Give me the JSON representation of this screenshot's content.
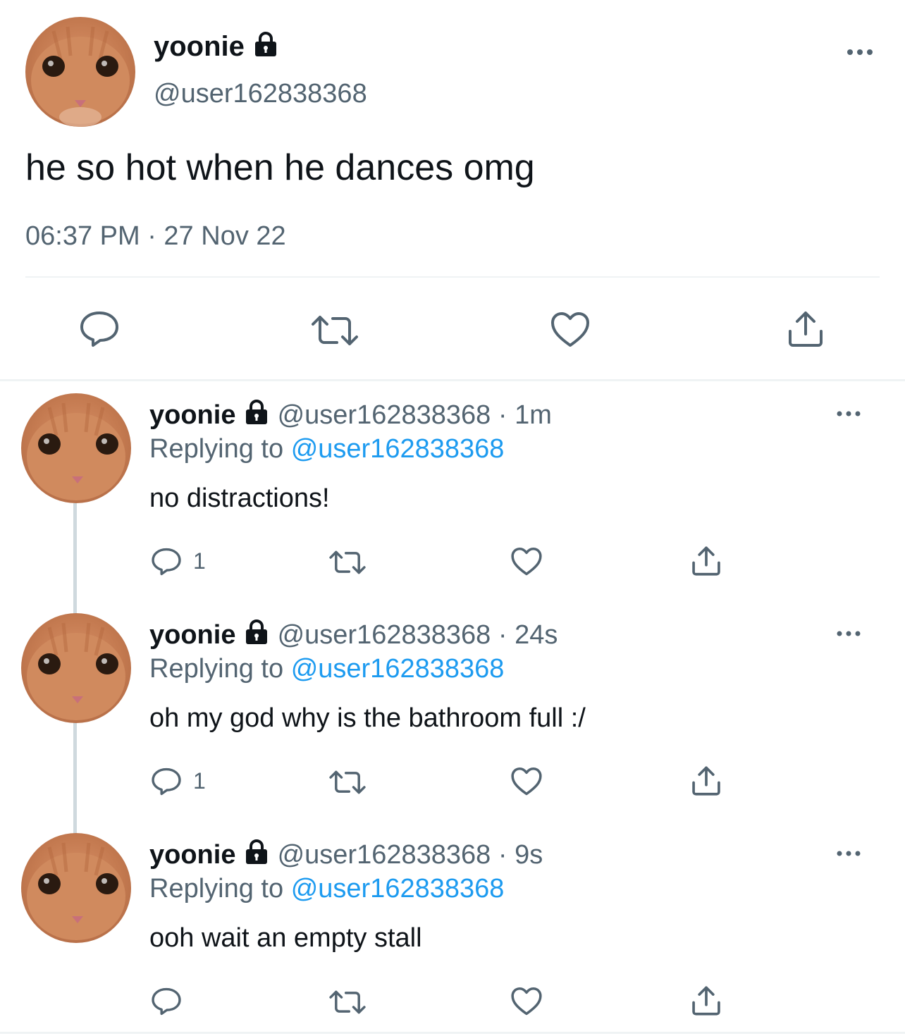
{
  "main_tweet": {
    "name": "yoonie",
    "handle": "@user162838368",
    "text": "he so hot when he dances omg",
    "timestamp": "06:37 PM · 27 Nov 22"
  },
  "replies": [
    {
      "name": "yoonie",
      "handle_time": "@user162838368 · 1m",
      "replying_prefix": "Replying to",
      "replying_to": "@user162838368",
      "text": "no distractions!",
      "reply_count": "1"
    },
    {
      "name": "yoonie",
      "handle_time": "@user162838368 · 24s",
      "replying_prefix": "Replying to",
      "replying_to": "@user162838368",
      "text": "oh my god why is the bathroom full :/",
      "reply_count": "1"
    },
    {
      "name": "yoonie",
      "handle_time": "@user162838368 · 9s",
      "replying_prefix": "Replying to",
      "replying_to": "@user162838368",
      "text": "ooh wait an empty stall",
      "reply_count": ""
    }
  ],
  "icons": {
    "lock": "lock-icon",
    "more": "more-icon",
    "reply": "reply-icon",
    "retweet": "retweet-icon",
    "like": "like-icon",
    "share": "share-icon"
  },
  "colors": {
    "text": "#0f1419",
    "secondary": "#536471",
    "link": "#1d9bf0",
    "divider": "#eff3f4",
    "avatar": "#c47a50"
  }
}
